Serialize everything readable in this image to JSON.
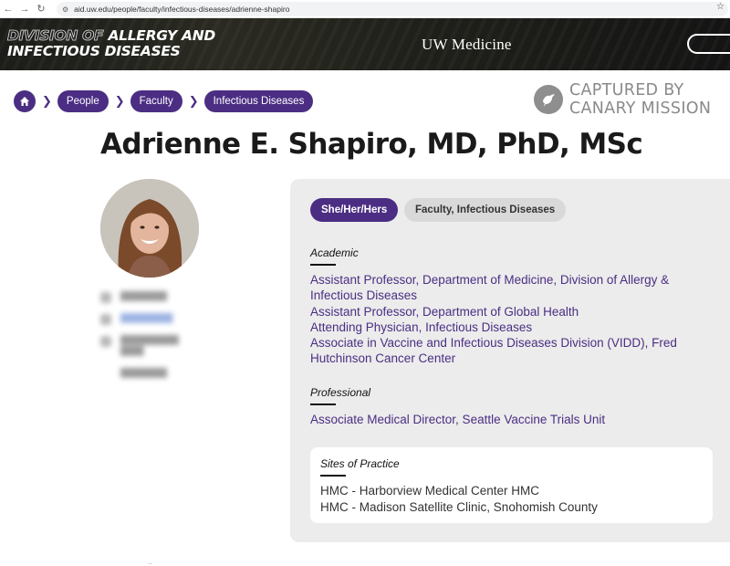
{
  "browser": {
    "url": "aid.uw.edu/people/faculty/infectious-diseases/adrienne-shapiro",
    "icons": [
      "back-icon",
      "forward-icon",
      "reload-icon",
      "site-settings-icon",
      "star-icon"
    ]
  },
  "header": {
    "division_line1_outline": "DIVISION OF",
    "division_line1_rest": " ALLERGY AND",
    "division_line2": "INFECTIOUS DISEASES",
    "brand": "UW Medicine"
  },
  "breadcrumb": {
    "home_icon": "home-icon",
    "items": [
      "People",
      "Faculty",
      "Infectious Diseases"
    ]
  },
  "watermark": {
    "line1": "CAPTURED BY",
    "line2": "CANARY MISSION",
    "icon": "canary-bird-icon"
  },
  "profile": {
    "name": "Adrienne E. Shapiro, MD, PhD, MSc",
    "pronouns": "She/Her/Hers",
    "role_tag": "Faculty, Infectious Diseases"
  },
  "academic": {
    "heading": "Academic",
    "lines": [
      "Assistant Professor, Department of Medicine, Division of Allergy &",
      "Infectious Diseases",
      "Assistant Professor, Department of Global Health",
      "Attending Physician, Infectious Diseases",
      "Associate in Vaccine and Infectious Diseases Division (VIDD), Fred",
      "Hutchinson Cancer Center"
    ]
  },
  "professional": {
    "heading": "Professional",
    "lines": [
      "Associate Medical Director, Seattle Vaccine Trials Unit"
    ]
  },
  "sites": {
    "heading": "Sites of Practice",
    "lines": [
      "HMC - Harborview Medical Center HMC",
      "HMC - Madison Satellite Clinic, Snohomish County"
    ]
  },
  "colors": {
    "uw_purple": "#4b2e83",
    "panel_bg": "#ececec",
    "watermark_grey": "#8a8a8a"
  }
}
